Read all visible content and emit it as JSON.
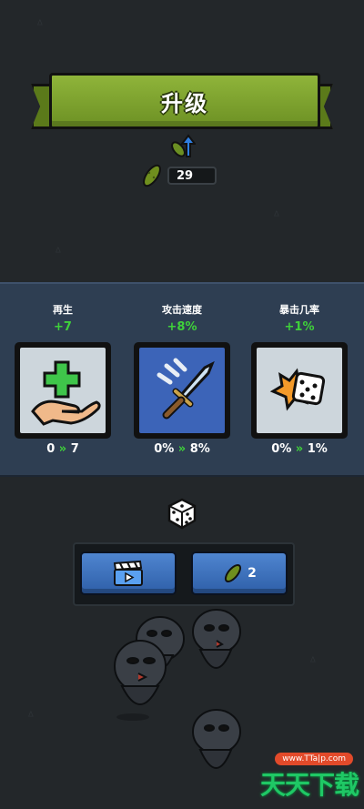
{
  "header": {
    "title": "升级"
  },
  "currency": {
    "pickles": "29"
  },
  "stats": [
    {
      "name": "再生",
      "bonus": "+7",
      "from": "0",
      "to": "7",
      "icon": "healing-hand-icon"
    },
    {
      "name": "攻击速度",
      "bonus": "+8%",
      "from": "0%",
      "to": "8%",
      "icon": "fast-sword-icon"
    },
    {
      "name": "暴击几率",
      "bonus": "+1%",
      "from": "0%",
      "to": "1%",
      "icon": "crit-dice-icon"
    }
  ],
  "arrow_glyph": "»",
  "reroll": {
    "icon": "dice-icon"
  },
  "buttons": {
    "watch_ad": {
      "icon": "clapperboard-icon"
    },
    "pickle_cost": "2"
  },
  "watermark": {
    "url": "www.TTa|p.com",
    "brand": "天天下载"
  },
  "colors": {
    "accent_green": "#3fd13a",
    "ribbon": "#7fa32e",
    "stat_band": "#2e3e52",
    "button_blue": "#3b6fbf"
  }
}
